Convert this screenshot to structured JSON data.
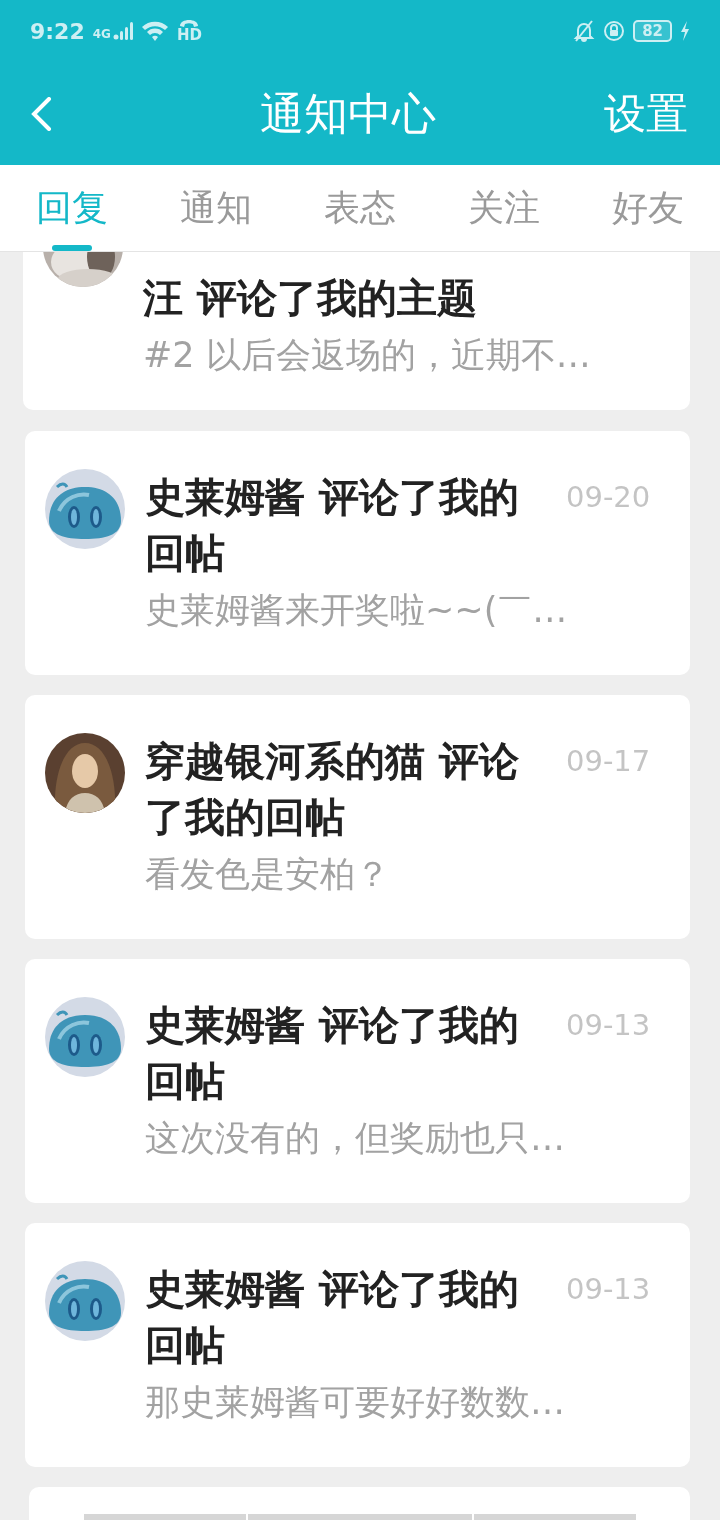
{
  "status_bar": {
    "time": "9:22",
    "network": "4G",
    "call": "HD",
    "battery": "82"
  },
  "header": {
    "title": "通知中心",
    "action": "设置"
  },
  "tabs": [
    {
      "label": "回复",
      "selected": true
    },
    {
      "label": "通知",
      "selected": false
    },
    {
      "label": "表态",
      "selected": false
    },
    {
      "label": "关注",
      "selected": false
    },
    {
      "label": "好友",
      "selected": false
    }
  ],
  "notifications": [
    {
      "title": "汪 评论了我的主题",
      "snippet": "#2 以后会返场的，近期不…",
      "clipped": true
    },
    {
      "title": "史莱姆酱 评论了我的回帖",
      "date": "09-20",
      "snippet": "史莱姆酱来开奖啦~~(￣…",
      "clipped": false
    },
    {
      "title": "穿越银河系的猫 评论了我的回帖",
      "date": "09-17",
      "snippet": "看发色是安柏？",
      "clipped": false
    },
    {
      "title": "史莱姆酱 评论了我的回帖",
      "date": "09-13",
      "snippet": "这次没有的，但奖励也只…",
      "clipped": false
    },
    {
      "title": "史莱姆酱 评论了我的回帖",
      "date": "09-13",
      "snippet": "那史莱姆酱可要好好数数…",
      "clipped": false
    }
  ]
}
